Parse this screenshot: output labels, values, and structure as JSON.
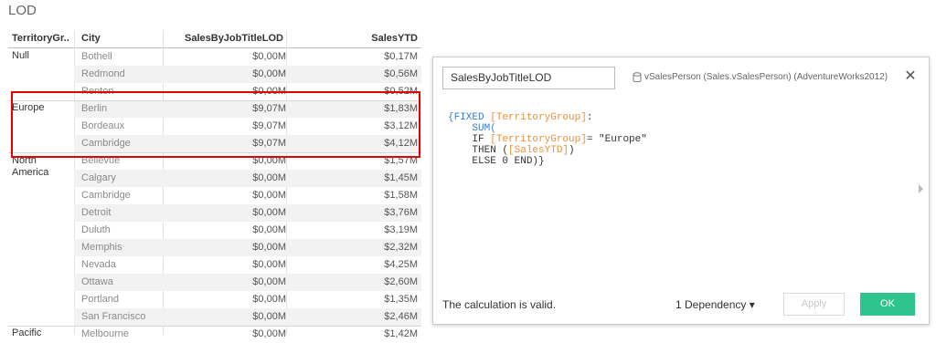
{
  "sheet": {
    "title": "LOD"
  },
  "table": {
    "headers": {
      "territory": "TerritoryGr..",
      "city": "City",
      "lod": "SalesByJobTitleLOD",
      "ytd": "SalesYTD"
    },
    "groups": [
      "Null",
      "Europe",
      "North\nAmerica",
      "Pacific"
    ],
    "rows": [
      {
        "city": "Bothell",
        "lod": "$0,00M",
        "ytd": "$0,17M"
      },
      {
        "city": "Redmond",
        "lod": "$0,00M",
        "ytd": "$0,56M"
      },
      {
        "city": "Renton",
        "lod": "$0,00M",
        "ytd": "$0,52M"
      },
      {
        "city": "Berlin",
        "lod": "$9,07M",
        "ytd": "$1,83M"
      },
      {
        "city": "Bordeaux",
        "lod": "$9,07M",
        "ytd": "$3,12M"
      },
      {
        "city": "Cambridge",
        "lod": "$9,07M",
        "ytd": "$4,12M"
      },
      {
        "city": "Bellevue",
        "lod": "$0,00M",
        "ytd": "$1,57M"
      },
      {
        "city": "Calgary",
        "lod": "$0,00M",
        "ytd": "$1,45M"
      },
      {
        "city": "Cambridge",
        "lod": "$0,00M",
        "ytd": "$1,58M"
      },
      {
        "city": "Detroit",
        "lod": "$0,00M",
        "ytd": "$3,76M"
      },
      {
        "city": "Duluth",
        "lod": "$0,00M",
        "ytd": "$3,19M"
      },
      {
        "city": "Memphis",
        "lod": "$0,00M",
        "ytd": "$2,32M"
      },
      {
        "city": "Nevada",
        "lod": "$0,00M",
        "ytd": "$4,25M"
      },
      {
        "city": "Ottawa",
        "lod": "$0,00M",
        "ytd": "$2,60M"
      },
      {
        "city": "Portland",
        "lod": "$0,00M",
        "ytd": "$1,35M"
      },
      {
        "city": "San Francisco",
        "lod": "$0,00M",
        "ytd": "$2,46M"
      },
      {
        "city": "Melbourne",
        "lod": "$0,00M",
        "ytd": "$1,42M"
      }
    ]
  },
  "calc_dialog": {
    "name": "SalesByJobTitleLOD",
    "datasource": "vSalesPerson (Sales.vSalesPerson) (AdventureWorks2012)",
    "close_label": "✕",
    "code": {
      "l1_open": "{FIXED ",
      "l1_field": "[TerritoryGroup]",
      "l1_colon": ":",
      "l2_sum": "SUM(",
      "l3_if": "IF ",
      "l3_field": "[TerritoryGroup]",
      "l3_rest": "= \"Europe\"",
      "l4_then": "THEN (",
      "l4_field": "[SalesYTD]",
      "l4_close": ")",
      "l5": "ELSE 0 END)}"
    },
    "status": "The calculation is valid.",
    "dependency": "1 Dependency ▾",
    "apply": "Apply",
    "ok": "OK"
  },
  "colors": {
    "highlight": "#e30000",
    "ok_button": "#2dc48d",
    "keyword": "#3b7bd4",
    "field": "#e8913a"
  }
}
